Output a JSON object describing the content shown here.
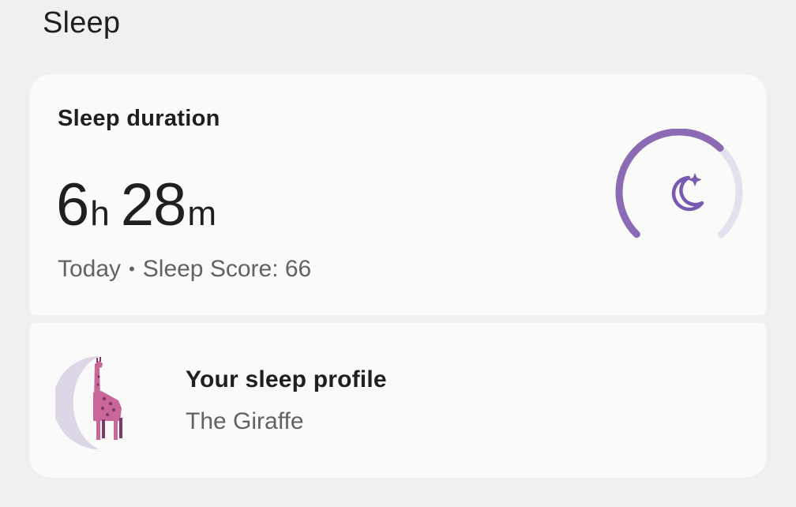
{
  "page": {
    "title": "Sleep"
  },
  "duration_card": {
    "heading": "Sleep duration",
    "hours": "6",
    "hours_unit": "h",
    "minutes": "28",
    "minutes_unit": "m",
    "day": "Today",
    "separator": "•",
    "score_text": "Sleep Score: 66",
    "sleep_score": 66,
    "ring_icon": "moon-stars-icon",
    "colors": {
      "ring_fill": "#8c6bb5",
      "ring_track": "#e4e0ee",
      "icon": "#7a5ab0"
    }
  },
  "profile_card": {
    "title": "Your sleep profile",
    "animal": "The Giraffe",
    "illustration": "giraffe-moon-illustration",
    "colors": {
      "moon": "#dcd6e6",
      "giraffe": "#c9679a",
      "giraffe_dark": "#7d3a68"
    }
  }
}
